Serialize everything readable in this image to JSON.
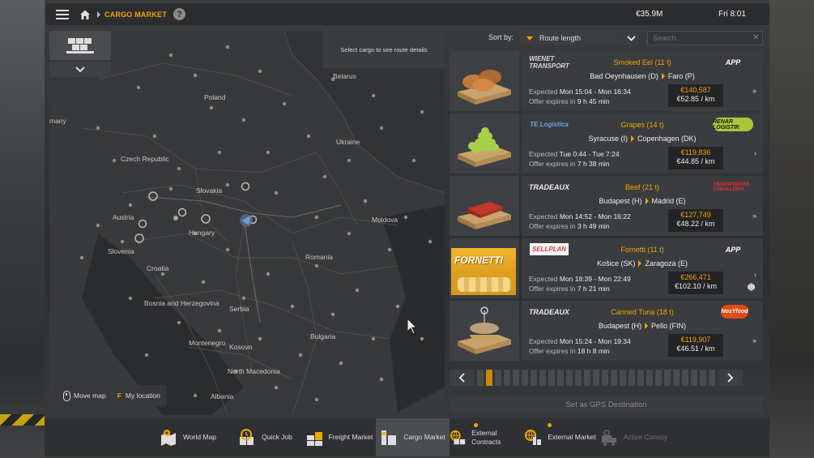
{
  "topbar": {
    "breadcrumb": "CARGO MARKET",
    "help": "?",
    "money": "€35.9M",
    "clock": "Fri 8:01"
  },
  "map": {
    "hint": "Select cargo to see route details",
    "labels": [
      "Belarus",
      "Poland",
      "many",
      "Ukraine",
      "Czech Republic",
      "Slovakia",
      "Austria",
      "Hungary",
      "Moldova",
      "Slovenia",
      "Croatia",
      "Romania",
      "Bosnia and Herzegovina",
      "Serbia",
      "Bulgaria",
      "Montenegro",
      "Kosovo",
      "North Macedonia",
      "Albania"
    ],
    "controls": {
      "move_map": "Move map",
      "key_f": "F",
      "my_location": "My location"
    }
  },
  "sort": {
    "label": "Sort by:",
    "value": "Route length",
    "search_placeholder": "Search..."
  },
  "offers": [
    {
      "company_left": "WIENET TRANSPORT",
      "company_right": "APP",
      "cargo": "Smoked Eel (11 t)",
      "from": "Bad Oeynhausen (D)",
      "to": "Faro (P)",
      "expected_label": "Expected",
      "expected": "Mon 15:04 - Mon 16:34",
      "expires_label": "Offer expires in",
      "expires": "9 h 45 min",
      "price": "€140,587",
      "per_km": "€52.85 / km",
      "urgency": "»"
    },
    {
      "company_left": "TE Logistica",
      "company_right": "RENAR LOGISTIK",
      "cargo": "Grapes (14 t)",
      "from": "Syracuse (I)",
      "to": "Copenhagen (DK)",
      "expected_label": "Expected",
      "expected": "Tue 0:44 - Tue 7:24",
      "expires_label": "Offer expires in",
      "expires": "7 h 38 min",
      "price": "€119,836",
      "per_km": "€44.85 / km",
      "urgency": "›"
    },
    {
      "company_left": "TRADEAUX",
      "company_right": "TRANSPORTES CABALLERÍA",
      "cargo": "Beef (21 t)",
      "from": "Budapest (H)",
      "to": "Madrid (E)",
      "expected_label": "Expected",
      "expected": "Mon 14:52 - Mon 16:22",
      "expires_label": "Offer expires in",
      "expires": "3 h 49 min",
      "price": "€127,749",
      "per_km": "€48.22 / km",
      "urgency": "»"
    },
    {
      "company_left": "SELLPLAN",
      "company_right": "APP",
      "cargo": "Fornetti (11 t)",
      "from": "Košice (SK)",
      "to": "Zaragoza (E)",
      "expected_label": "Expected",
      "expected": "Mon 18:39 - Mon 22:49",
      "expires_label": "Offer expires in",
      "expires": "7 h 21 min",
      "price": "€266,471",
      "per_km": "€102.10 / km",
      "urgency": "›",
      "thumb_text": "FORNETTI"
    },
    {
      "company_left": "TRADEAUX",
      "company_right": "NosYfood",
      "cargo": "Canned Tuna (18 t)",
      "from": "Budapest (H)",
      "to": "Pello (FIN)",
      "expected_label": "Expected",
      "expected": "Mon 15:24 - Mon 19:34",
      "expires_label": "Offer expires in",
      "expires": "18 h 8 min",
      "price": "€119,907",
      "per_km": "€46.51 / km",
      "urgency": "»"
    }
  ],
  "gps_button": "Set as GPS Destination",
  "nav": [
    {
      "label": "World Map",
      "icon": "world-map-icon"
    },
    {
      "label": "Quick Job",
      "icon": "quick-job-icon"
    },
    {
      "label": "Freight Market",
      "icon": "freight-market-icon"
    },
    {
      "label": "Cargo Market",
      "icon": "cargo-market-icon",
      "active": true
    },
    {
      "label": "External Contracts",
      "icon": "external-contracts-icon",
      "notification": true
    },
    {
      "label": "External Market",
      "icon": "external-market-icon",
      "notification": true
    },
    {
      "label": "Active Convoy",
      "icon": "active-convoy-icon",
      "disabled": true
    }
  ],
  "colors": {
    "accent": "#f0a500",
    "panel": "#3a3c3f",
    "background": "#2c2e30"
  }
}
